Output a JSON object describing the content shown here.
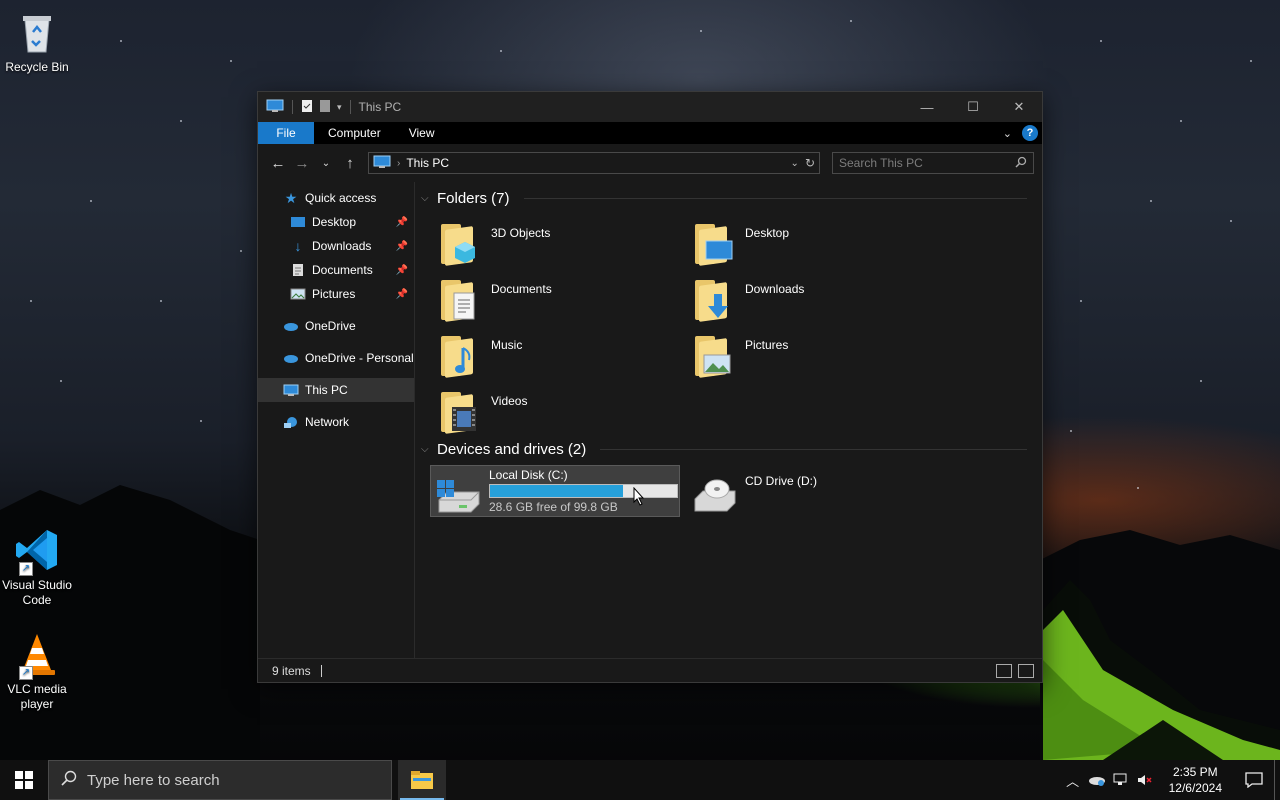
{
  "desktop": {
    "icons": [
      {
        "label": "Recycle Bin",
        "icon": "recycle-bin-icon"
      },
      {
        "label": "Visual Studio Code",
        "icon": "vscode-icon"
      },
      {
        "label": "VLC media player",
        "icon": "vlc-icon"
      }
    ]
  },
  "window": {
    "title": "This PC",
    "ribbon": {
      "tabs": [
        "File",
        "Computer",
        "View"
      ],
      "active_tab": "File",
      "accent": "#1979ca"
    },
    "address": {
      "path": "This PC"
    },
    "search": {
      "placeholder": "Search This PC"
    },
    "sidebar": {
      "quick_access": "Quick access",
      "pinned": [
        "Desktop",
        "Downloads",
        "Documents",
        "Pictures"
      ],
      "onedrive": "OneDrive",
      "onedrive_personal": "OneDrive - Personal",
      "this_pc": "This PC",
      "network": "Network"
    },
    "folders": {
      "heading": "Folders (7)",
      "items": [
        "3D Objects",
        "Desktop",
        "Documents",
        "Downloads",
        "Music",
        "Pictures",
        "Videos"
      ]
    },
    "devices": {
      "heading": "Devices and drives (2)",
      "items": [
        {
          "name": "Local Disk (C:)",
          "free_text": "28.6 GB free of 99.8 GB",
          "used_fraction": 0.713,
          "bar_color": "#26a0da"
        },
        {
          "name": "CD Drive (D:)"
        }
      ]
    },
    "status": {
      "item_count": "9 items"
    }
  },
  "taskbar": {
    "search_placeholder": "Type here to search",
    "time": "2:35 PM",
    "date": "12/6/2024"
  }
}
